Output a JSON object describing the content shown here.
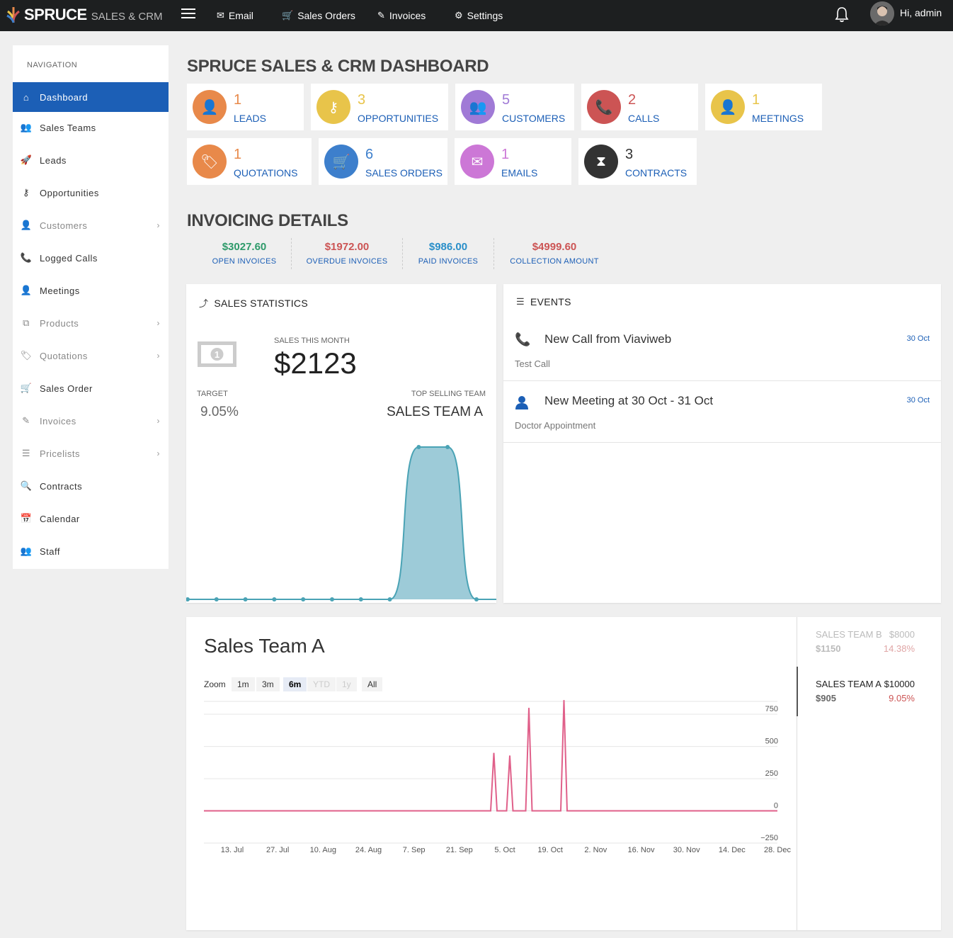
{
  "topbar": {
    "logo": "SPRUCE",
    "logo_sub": "SALES & CRM",
    "nav": [
      {
        "label": "Email",
        "icon": "envelope-icon"
      },
      {
        "label": "Sales Orders",
        "icon": "cart-icon"
      },
      {
        "label": "Invoices",
        "icon": "edit-icon"
      },
      {
        "label": "Settings",
        "icon": "gear-icon"
      }
    ],
    "greeting": "Hi, admin"
  },
  "sidebar": {
    "heading": "NAVIGATION",
    "items": [
      {
        "label": "Dashboard",
        "icon": "home-icon",
        "active": true
      },
      {
        "label": "Sales Teams",
        "icon": "users-icon"
      },
      {
        "label": "Leads",
        "icon": "rocket-icon"
      },
      {
        "label": "Opportunities",
        "icon": "key-icon"
      },
      {
        "label": "Customers",
        "icon": "user-icon",
        "submenu": true
      },
      {
        "label": "Logged Calls",
        "icon": "phone-icon"
      },
      {
        "label": "Meetings",
        "icon": "user-solid-icon"
      },
      {
        "label": "Products",
        "icon": "cubes-icon",
        "submenu": true
      },
      {
        "label": "Quotations",
        "icon": "tag-icon",
        "submenu": true
      },
      {
        "label": "Sales Order",
        "icon": "cart-icon"
      },
      {
        "label": "Invoices",
        "icon": "edit-icon",
        "submenu": true
      },
      {
        "label": "Pricelists",
        "icon": "list-icon",
        "submenu": true
      },
      {
        "label": "Contracts",
        "icon": "search-plus-icon"
      },
      {
        "label": "Calendar",
        "icon": "calendar-icon"
      },
      {
        "label": "Staff",
        "icon": "users-icon"
      }
    ]
  },
  "dashboard": {
    "title": "SPRUCE SALES & CRM DASHBOARD",
    "cards": [
      {
        "value": "1",
        "label": "LEADS",
        "color": "#e8894a",
        "icon": "user-icon"
      },
      {
        "value": "3",
        "label": "OPPORTUNITIES",
        "color": "#e8c44a",
        "icon": "key-icon"
      },
      {
        "value": "5",
        "label": "CUSTOMERS",
        "color": "#a07ad6",
        "icon": "users-icon"
      },
      {
        "value": "2",
        "label": "CALLS",
        "color": "#cc5454",
        "icon": "phone-icon"
      },
      {
        "value": "1",
        "label": "MEETINGS",
        "color": "#e8c44a",
        "icon": "user-icon"
      },
      {
        "value": "1",
        "label": "QUOTATIONS",
        "color": "#e8894a",
        "icon": "tag-icon"
      },
      {
        "value": "6",
        "label": "SALES ORDERS",
        "color": "#3d7fcc",
        "icon": "cart-icon"
      },
      {
        "value": "1",
        "label": "EMAILS",
        "color": "#cc77d6",
        "icon": "envelope-icon"
      },
      {
        "value": "3",
        "label": "CONTRACTS",
        "color": "#333333",
        "icon": "hourglass-icon"
      }
    ]
  },
  "invoicing": {
    "title": "INVOICING DETAILS",
    "items": [
      {
        "amount": "$3027.60",
        "caption": "OPEN INVOICES",
        "color": "#2e9a6a"
      },
      {
        "amount": "$1972.00",
        "caption": "OVERDUE INVOICES",
        "color": "#cc5454"
      },
      {
        "amount": "$986.00",
        "caption": "PAID INVOICES",
        "color": "#2a8fc9"
      },
      {
        "amount": "$4999.60",
        "caption": "COLLECTION AMOUNT",
        "color": "#cc5454"
      }
    ]
  },
  "sales_stats": {
    "title": "SALES STATISTICS",
    "month_caption": "SALES THIS MONTH",
    "month_value": "$2123",
    "target_caption": "TARGET",
    "target_value": "9.05%",
    "top_caption": "TOP SELLING TEAM",
    "top_value": "SALES TEAM A"
  },
  "events": {
    "title": "EVENTS",
    "items": [
      {
        "title": "New Call from Viaviweb",
        "date": "30 Oct",
        "sub": "Test Call",
        "icon": "phone-icon"
      },
      {
        "title": "New Meeting at 30 Oct - 31 Oct",
        "date": "30 Oct",
        "sub": "Doctor Appointment",
        "icon": "user-solid-icon"
      }
    ]
  },
  "team_chart": {
    "title": "Sales Team A",
    "zoom_label": "Zoom",
    "zoom_buttons": [
      {
        "label": "1m",
        "state": "normal"
      },
      {
        "label": "3m",
        "state": "normal"
      },
      {
        "label": "6m",
        "state": "selected"
      },
      {
        "label": "YTD",
        "state": "disabled"
      },
      {
        "label": "1y",
        "state": "disabled"
      },
      {
        "label": "All",
        "state": "normal"
      }
    ]
  },
  "teams": [
    {
      "name": "SALES TEAM B",
      "target": "$8000",
      "actual": "$1150",
      "percent": "14.38%",
      "dim": true
    },
    {
      "name": "SALES TEAM A",
      "target": "$10000",
      "actual": "$905",
      "percent": "9.05%",
      "dim": false
    }
  ],
  "chart_data": [
    {
      "type": "area",
      "title": "",
      "x": [
        1,
        2,
        3,
        4,
        5,
        6,
        7,
        8,
        9,
        10,
        11
      ],
      "values": [
        0,
        0,
        0,
        0,
        0,
        0,
        0,
        0,
        100,
        100,
        0
      ],
      "ylim": [
        0,
        100
      ],
      "color": "#9dcbd8",
      "grid": false
    },
    {
      "type": "line",
      "title": "Sales Team A",
      "xlabel": "",
      "ylabel": "",
      "x_tick_labels": [
        "13. Jul",
        "27. Jul",
        "10. Aug",
        "24. Aug",
        "7. Sep",
        "21. Sep",
        "5. Oct",
        "19. Oct",
        "2. Nov",
        "16. Nov",
        "30. Nov",
        "14. Dec",
        "28. Dec"
      ],
      "y_ticks": [
        -250,
        0,
        250,
        500,
        750
      ],
      "ylim": [
        -250,
        850
      ],
      "grid": true,
      "series": [
        {
          "color": "#e0608a",
          "points": [
            {
              "x": "2017-07-04",
              "y": 0
            },
            {
              "x": "2017-10-02",
              "y": 0
            },
            {
              "x": "2017-10-03",
              "y": 450
            },
            {
              "x": "2017-10-04",
              "y": 0
            },
            {
              "x": "2017-10-07",
              "y": 0
            },
            {
              "x": "2017-10-08",
              "y": 430
            },
            {
              "x": "2017-10-09",
              "y": 0
            },
            {
              "x": "2017-10-13",
              "y": 0
            },
            {
              "x": "2017-10-14",
              "y": 800
            },
            {
              "x": "2017-10-15",
              "y": 0
            },
            {
              "x": "2017-10-24",
              "y": 0
            },
            {
              "x": "2017-10-25",
              "y": 860
            },
            {
              "x": "2017-10-26",
              "y": 0
            },
            {
              "x": "2017-12-31",
              "y": 0
            }
          ]
        }
      ]
    }
  ]
}
